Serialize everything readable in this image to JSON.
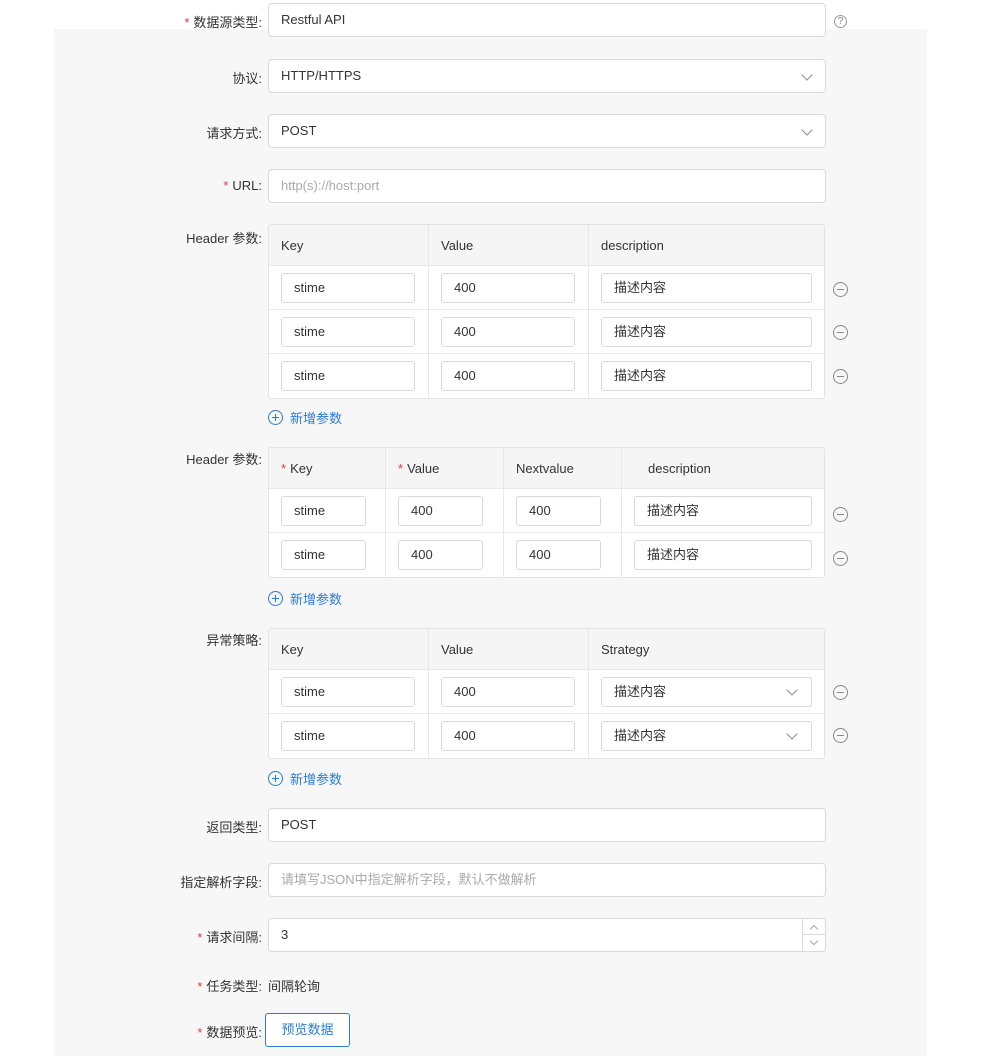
{
  "form": {
    "datasource_type": {
      "label": "数据源类型:",
      "required": "*",
      "value": "Restful API",
      "help_icon": "question-circle-icon"
    },
    "protocol": {
      "label": "协议:",
      "value": "HTTP/HTTPS"
    },
    "method": {
      "label": "请求方式:",
      "value": "POST"
    },
    "url": {
      "label": "URL:",
      "required": "*",
      "placeholder": "http(s)://host:port"
    },
    "header1": {
      "label": "Header 参数:",
      "columns": [
        "Key",
        "Value",
        "description"
      ],
      "rows": [
        {
          "key": "stime",
          "value": "400",
          "desc": "描述内容"
        },
        {
          "key": "stime",
          "value": "400",
          "desc": "描述内容"
        },
        {
          "key": "stime",
          "value": "400",
          "desc": "描述内容"
        }
      ],
      "add_label": "新增参数"
    },
    "header2": {
      "label": "Header 参数:",
      "required": "*",
      "columns": [
        "Key",
        "Value",
        "Nextvalue",
        "description"
      ],
      "rows": [
        {
          "key": "stime",
          "value": "400",
          "next": "400",
          "desc": "描述内容"
        },
        {
          "key": "stime",
          "value": "400",
          "next": "400",
          "desc": "描述内容"
        }
      ],
      "add_label": "新增参数"
    },
    "exception": {
      "label": "异常策略:",
      "columns": [
        "Key",
        "Value",
        "Strategy"
      ],
      "rows": [
        {
          "key": "stime",
          "value": "400",
          "strategy": "描述内容"
        },
        {
          "key": "stime",
          "value": "400",
          "strategy": "描述内容"
        }
      ],
      "add_label": "新增参数"
    },
    "return_type": {
      "label": "返回类型:",
      "value": "POST"
    },
    "parse_field": {
      "label": "指定解析字段:",
      "placeholder": "请填写JSON中指定解析字段，默认不做解析"
    },
    "interval": {
      "label": "请求间隔:",
      "required": "*",
      "value": "3"
    },
    "task_type": {
      "label": "任务类型:",
      "required": "*",
      "value": "间隔轮询"
    },
    "preview": {
      "label": "数据预览:",
      "required": "*",
      "button": "预览数据"
    }
  },
  "colors": {
    "accent": "#2b7cd8",
    "required": "#e4393c",
    "panel": "#f7f7f7"
  }
}
